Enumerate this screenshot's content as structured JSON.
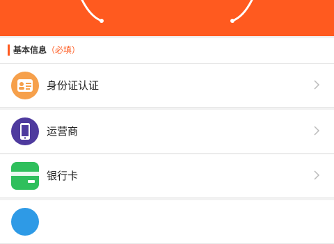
{
  "colors": {
    "accent": "#ff5a1f",
    "id_icon": "#f6a04b",
    "carrier_icon": "#4e3a9e",
    "bank_icon": "#2fbf5c",
    "partial_icon": "#2e9ae6"
  },
  "section": {
    "title": "基本信息",
    "required_note": "（必填）"
  },
  "items": [
    {
      "label": "身份证认证",
      "icon": "id-card-icon"
    },
    {
      "label": "运营商",
      "icon": "mobile-phone-icon"
    },
    {
      "label": "银行卡",
      "icon": "bank-card-icon"
    },
    {
      "label": "",
      "icon": "partial-icon"
    }
  ]
}
